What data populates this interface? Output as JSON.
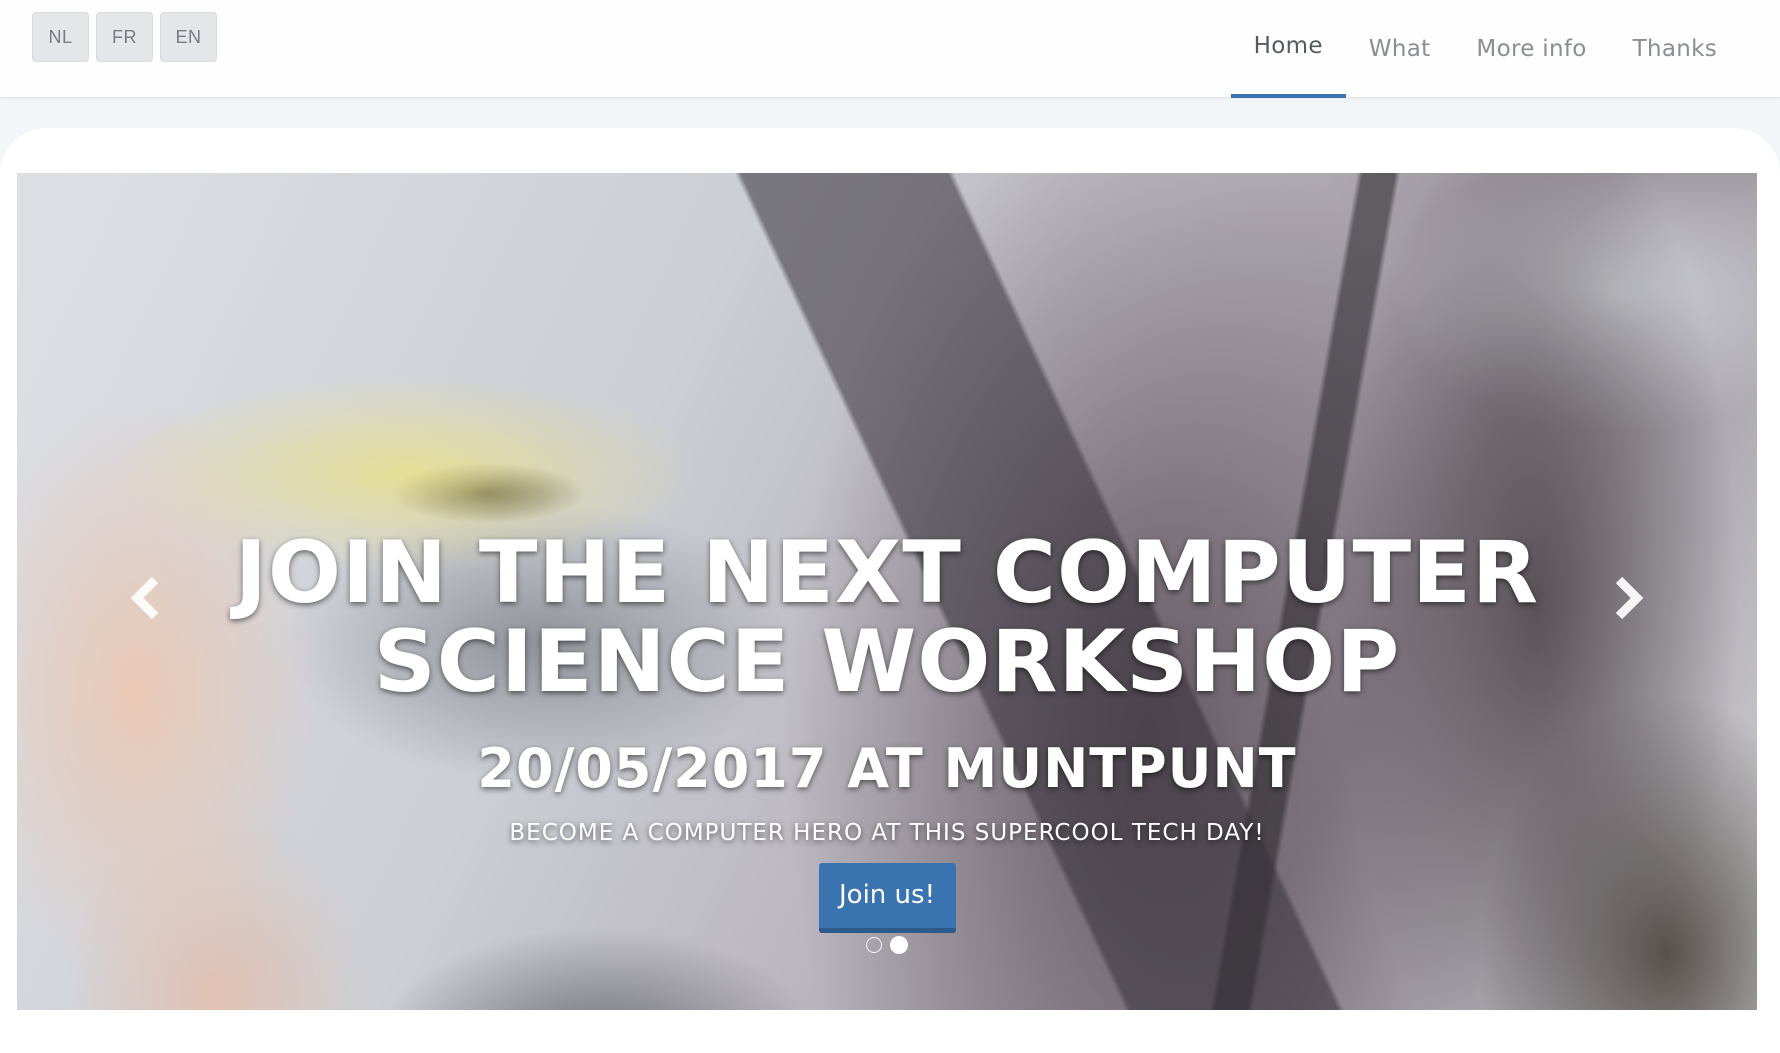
{
  "languages": [
    {
      "label": "NL"
    },
    {
      "label": "FR"
    },
    {
      "label": "EN"
    }
  ],
  "nav": {
    "items": [
      {
        "label": "Home",
        "active": true
      },
      {
        "label": "What",
        "active": false
      },
      {
        "label": "More info",
        "active": false
      },
      {
        "label": "Thanks",
        "active": false
      }
    ]
  },
  "hero": {
    "title_line1": "JOIN THE NEXT COMPUTER",
    "title_line2": "SCIENCE WORKSHOP",
    "subtitle": "20/05/2017 AT MUNTPUNT",
    "tagline": "BECOME A COMPUTER HERO AT THIS SUPERCOOL TECH DAY!",
    "cta_label": "Join us!",
    "slide_count": 2,
    "active_slide": 2,
    "prev_icon": "chevron-left-icon",
    "next_icon": "chevron-right-icon"
  },
  "colors": {
    "accent": "#3a74b0",
    "nav_text": "#8a8d93",
    "lang_button_bg": "#e5e6ea"
  }
}
